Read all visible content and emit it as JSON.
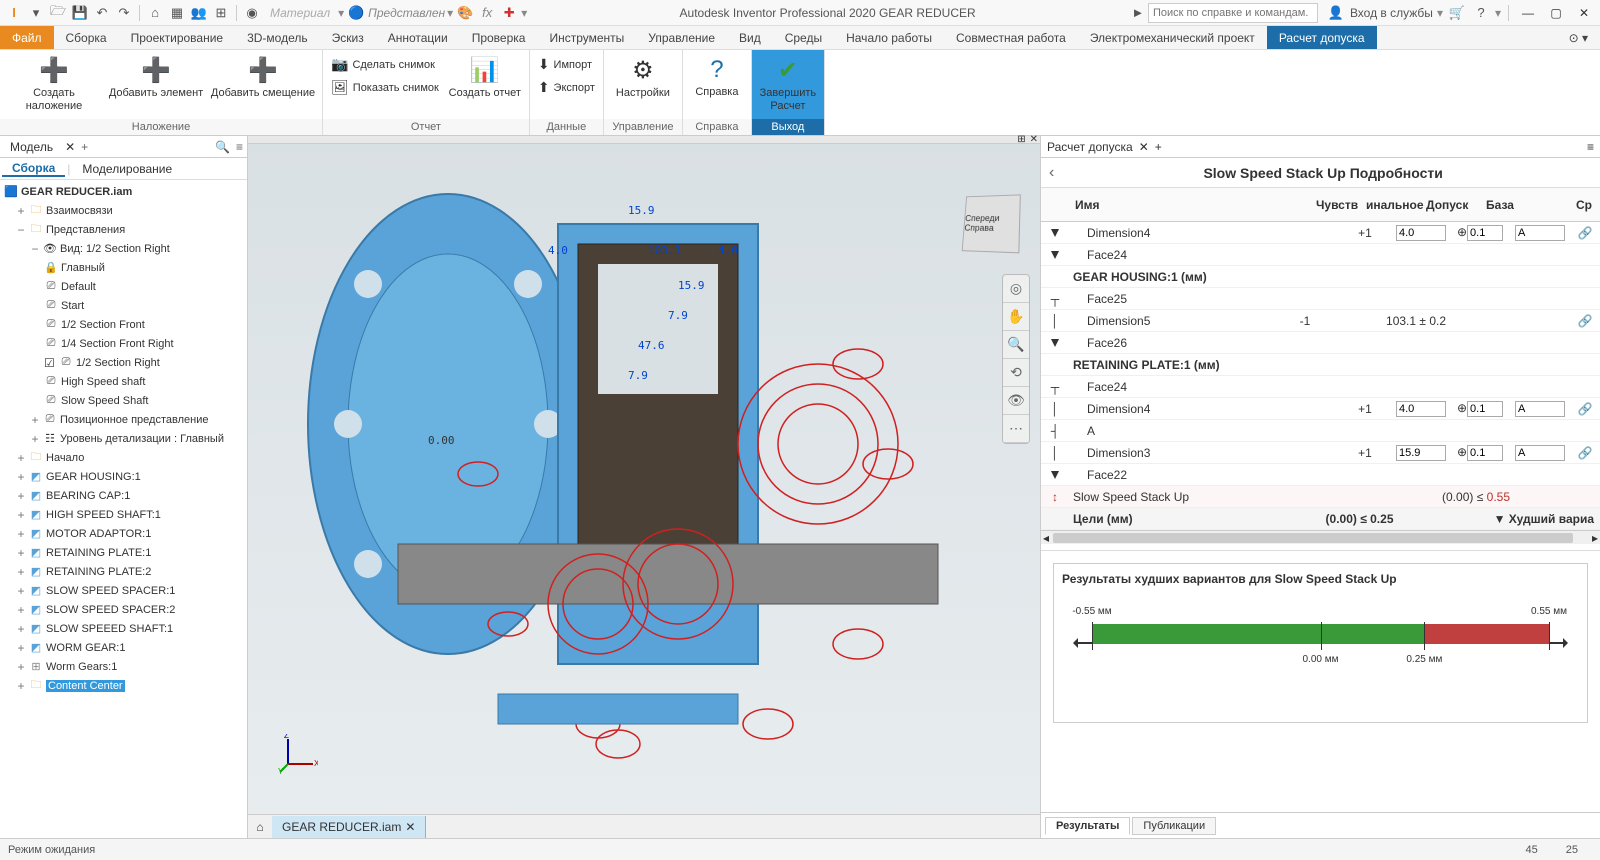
{
  "titlebar": {
    "material": "Материал",
    "view": "Представлен",
    "app": "Autodesk Inventor Professional 2020   GEAR REDUCER",
    "search_ph": "Поиск по справке и командам.",
    "login": "Вход в службы"
  },
  "ribbonTabs": {
    "file": "Файл",
    "items": [
      "Сборка",
      "Проектирование",
      "3D-модель",
      "Эскиз",
      "Аннотации",
      "Проверка",
      "Инструменты",
      "Управление",
      "Вид",
      "Среды",
      "Начало работы",
      "Совместная работа",
      "Электромеханический проект",
      "Расчет допуска"
    ]
  },
  "ribbon": {
    "g1": {
      "title": "Наложение",
      "b1": "Создать наложение",
      "b2": "Добавить элемент",
      "b3": "Добавить смещение"
    },
    "g2": {
      "title": "Отчет",
      "b1": "Сделать снимок",
      "b2": "Показать снимок",
      "b3": "Создать отчет"
    },
    "g3": {
      "title": "Данные",
      "b1": "Импорт",
      "b2": "Экспорт"
    },
    "g4": {
      "title": "Управление",
      "b1": "Настройки"
    },
    "g5": {
      "title": "Справка",
      "b1": "Справка"
    },
    "g6": {
      "title": "Выход",
      "b1": "Завершить Расчет"
    }
  },
  "leftPanel": {
    "tab": "Модель",
    "sub1": "Сборка",
    "sub2": "Моделирование",
    "root": "GEAR REDUCER.iam",
    "tree": {
      "rel": "Взаимосвязи",
      "repr": "Представления",
      "view": "Вид: 1/2 Section Right",
      "v1": "Главный",
      "v2": "Default",
      "v3": "Start",
      "v4": "1/2 Section Front",
      "v5": "1/4 Section Front Right",
      "v6": "1/2 Section Right",
      "v7": "High Speed shaft",
      "v8": "Slow Speed Shaft",
      "pos": "Позиционное представление",
      "lod": "Уровень детализации : Главный",
      "origin": "Начало",
      "p1": "GEAR HOUSING:1",
      "p2": "BEARING CAP:1",
      "p3": "HIGH SPEED SHAFT:1",
      "p4": "MOTOR ADAPTOR:1",
      "p5": "RETAINING PLATE:1",
      "p6": "RETAINING PLATE:2",
      "p7": "SLOW SPEED SPACER:1",
      "p8": "SLOW SPEED SPACER:2",
      "p9": "SLOW SPEEED SHAFT:1",
      "p10": "WORM GEAR:1",
      "p11": "Worm Gears:1",
      "p12": "Content Center"
    }
  },
  "docTab": "GEAR REDUCER.iam",
  "dims": {
    "d1": "15.9",
    "d2": "4.0",
    "d3": "103.1",
    "d4": "4.0",
    "d5": "15.9",
    "d6": "7.9",
    "d7": "47.6",
    "d8": "7.9",
    "d9": "0.00"
  },
  "viewcube": "Спереди Справа",
  "rightPanel": {
    "tab": "Расчет допуска",
    "title": "Slow Speed Stack Up Подробности",
    "cols": {
      "c1": "Имя",
      "c2": "Чувств",
      "c3": "инальное",
      "c4": "Допуск",
      "c5": "База",
      "c6": "Ср"
    },
    "rows": {
      "dim4": "Dimension4",
      "face24": "Face24",
      "gh": "GEAR HOUSING:1 (мм)",
      "face25": "Face25",
      "dim5": "Dimension5",
      "face26": "Face26",
      "rp": "RETAINING PLATE:1 (мм)",
      "face24b": "Face24",
      "dim4b": "Dimension4",
      "A": "A",
      "dim3": "Dimension3",
      "face22": "Face22",
      "stack": "Slow Speed Stack Up",
      "goals": "Цели (мм)",
      "worst": "Худший вариа"
    },
    "vals": {
      "p1": "+1",
      "p1b": "4.0",
      "p1c": "0.1",
      "p1d": "A",
      "m1": "-1",
      "d5": "103.1 ± 0.2",
      "p2": "+1",
      "p2b": "4.0",
      "p2c": "0.1",
      "p2d": "A",
      "p3": "+1",
      "p3b": "15.9",
      "p3c": "0.1",
      "p3d": "A",
      "stack_val": "(0.00) ≤",
      "stack_lim": "0.55",
      "goal_val": "(0.00) ≤ 0.25"
    }
  },
  "chart_data": {
    "type": "bar",
    "title": "Результаты худших вариантов для Slow Speed Stack Up",
    "range": {
      "min": -0.55,
      "max": 0.55
    },
    "ticks_bottom": [
      {
        "pos": 0.0,
        "label": "0.00 мм"
      },
      {
        "pos": 0.25,
        "label": "0.25 мм"
      }
    ],
    "ticks_top": [
      {
        "pos": -0.55,
        "label": "-0.55 мм"
      },
      {
        "pos": 0.55,
        "label": "0.55 мм"
      }
    ],
    "bars": [
      {
        "color": "green",
        "from": -0.55,
        "to": 0.25
      },
      {
        "color": "red",
        "from": 0.25,
        "to": 0.55
      }
    ]
  },
  "bottomTabs": {
    "t1": "Результаты",
    "t2": "Публикации"
  },
  "status": {
    "msg": "Режим ожидания",
    "n1": "45",
    "n2": "25"
  }
}
